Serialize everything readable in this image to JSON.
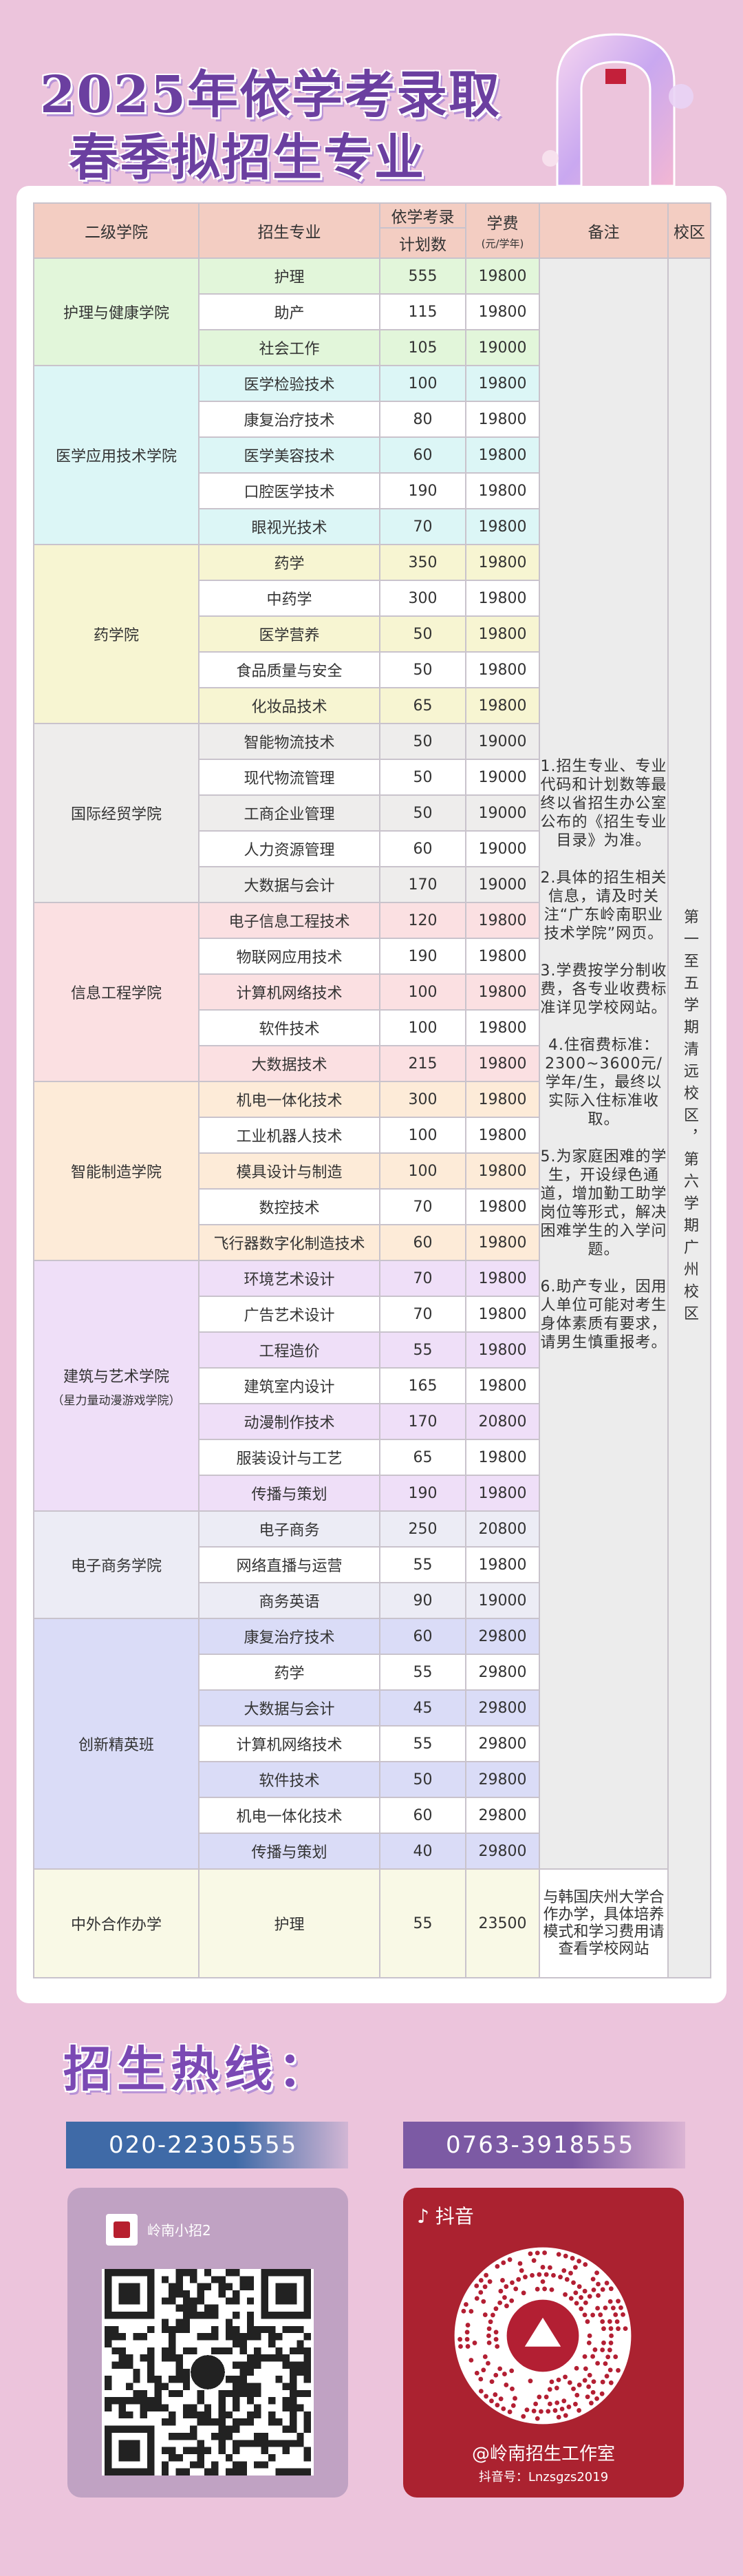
{
  "header": {
    "title_line1": "2025年依学考录取",
    "title_line2": "春季拟招生专业"
  },
  "table": {
    "head": {
      "college": "二级学院",
      "major": "招生专业",
      "plan_top": "依学考录",
      "plan_bottom": "计划数",
      "fee_top": "学费",
      "fee_bottom": "(元/学年)",
      "note": "备注",
      "campus": "校区"
    },
    "groups": [
      {
        "college": "护理与健康学院",
        "rows": [
          {
            "major": "护理",
            "num": "555",
            "fee": "19800"
          },
          {
            "major": "助产",
            "num": "115",
            "fee": "19800"
          },
          {
            "major": "社会工作",
            "num": "105",
            "fee": "19000"
          }
        ]
      },
      {
        "college": "医学应用技术学院",
        "rows": [
          {
            "major": "医学检验技术",
            "num": "100",
            "fee": "19800"
          },
          {
            "major": "康复治疗技术",
            "num": "80",
            "fee": "19800"
          },
          {
            "major": "医学美容技术",
            "num": "60",
            "fee": "19800"
          },
          {
            "major": "口腔医学技术",
            "num": "190",
            "fee": "19800"
          },
          {
            "major": "眼视光技术",
            "num": "70",
            "fee": "19800"
          }
        ]
      },
      {
        "college": "药学院",
        "rows": [
          {
            "major": "药学",
            "num": "350",
            "fee": "19800"
          },
          {
            "major": "中药学",
            "num": "300",
            "fee": "19800"
          },
          {
            "major": "医学营养",
            "num": "50",
            "fee": "19800"
          },
          {
            "major": "食品质量与安全",
            "num": "50",
            "fee": "19800"
          },
          {
            "major": "化妆品技术",
            "num": "65",
            "fee": "19800"
          }
        ]
      },
      {
        "college": "国际经贸学院",
        "rows": [
          {
            "major": "智能物流技术",
            "num": "50",
            "fee": "19000"
          },
          {
            "major": "现代物流管理",
            "num": "50",
            "fee": "19000"
          },
          {
            "major": "工商企业管理",
            "num": "50",
            "fee": "19000"
          },
          {
            "major": "人力资源管理",
            "num": "60",
            "fee": "19000"
          },
          {
            "major": "大数据与会计",
            "num": "170",
            "fee": "19000"
          }
        ]
      },
      {
        "college": "信息工程学院",
        "rows": [
          {
            "major": "电子信息工程技术",
            "num": "120",
            "fee": "19800"
          },
          {
            "major": "物联网应用技术",
            "num": "190",
            "fee": "19800"
          },
          {
            "major": "计算机网络技术",
            "num": "100",
            "fee": "19800"
          },
          {
            "major": "软件技术",
            "num": "100",
            "fee": "19800"
          },
          {
            "major": "大数据技术",
            "num": "215",
            "fee": "19800"
          }
        ]
      },
      {
        "college": "智能制造学院",
        "rows": [
          {
            "major": "机电一体化技术",
            "num": "300",
            "fee": "19800"
          },
          {
            "major": "工业机器人技术",
            "num": "100",
            "fee": "19800"
          },
          {
            "major": "模具设计与制造",
            "num": "100",
            "fee": "19800"
          },
          {
            "major": "数控技术",
            "num": "70",
            "fee": "19800"
          },
          {
            "major": "飞行器数字化制造技术",
            "num": "60",
            "fee": "19800"
          }
        ]
      },
      {
        "college": "建筑与艺术学院",
        "college_sub": "（星力量动漫游戏学院）",
        "rows": [
          {
            "major": "环境艺术设计",
            "num": "70",
            "fee": "19800"
          },
          {
            "major": "广告艺术设计",
            "num": "70",
            "fee": "19800"
          },
          {
            "major": "工程造价",
            "num": "55",
            "fee": "19800"
          },
          {
            "major": "建筑室内设计",
            "num": "165",
            "fee": "19800"
          },
          {
            "major": "动漫制作技术",
            "num": "170",
            "fee": "20800"
          },
          {
            "major": "服装设计与工艺",
            "num": "65",
            "fee": "19800"
          },
          {
            "major": "传播与策划",
            "num": "190",
            "fee": "19800"
          }
        ]
      },
      {
        "college": "电子商务学院",
        "rows": [
          {
            "major": "电子商务",
            "num": "250",
            "fee": "20800"
          },
          {
            "major": "网络直播与运营",
            "num": "55",
            "fee": "19800"
          },
          {
            "major": "商务英语",
            "num": "90",
            "fee": "19000"
          }
        ]
      },
      {
        "college": "创新精英班",
        "rows": [
          {
            "major": "康复治疗技术",
            "num": "60",
            "fee": "29800"
          },
          {
            "major": "药学",
            "num": "55",
            "fee": "29800"
          },
          {
            "major": "大数据与会计",
            "num": "45",
            "fee": "29800"
          },
          {
            "major": "计算机网络技术",
            "num": "55",
            "fee": "29800"
          },
          {
            "major": "软件技术",
            "num": "50",
            "fee": "29800"
          },
          {
            "major": "机电一体化技术",
            "num": "60",
            "fee": "29800"
          },
          {
            "major": "传播与策划",
            "num": "40",
            "fee": "29800"
          }
        ]
      }
    ],
    "coop": {
      "college": "中外合作办学",
      "major": "护理",
      "num": "55",
      "fee": "23500",
      "note": "与韩国庆州大学合作办学，具体培养模式和学习费用请查看学校网站"
    },
    "notes": [
      "1.招生专业、专业代码和计划数等最终以省招生办公室公布的《招生专业目录》为准。",
      "2.具体的招生相关信息，请及时关注“广东岭南职业技术学院”网页。",
      "3.学费按学分制收费，各专业收费标准详见学校网站。",
      "4.住宿费标准：2300~3600元/学年/生，最终以实际入住标准收取。",
      "5.为家庭困难的学生，开设绿色通道，增加勤工助学岗位等形式，解决困难学生的入学问题。",
      "6.助产专业，因用人单位可能对考生身体素质有要求，请男生慎重报考。"
    ],
    "campus_text": "第一至五学期清远校区，第六学期广州校区"
  },
  "hotline": {
    "title": "招生热线：",
    "phone1": "020-22305555",
    "phone2": "0763-3918555"
  },
  "wechat": {
    "name": "岭南小招2",
    "icon": "wechat-icon"
  },
  "douyin": {
    "app": "抖音",
    "name": "@岭南招生工作室",
    "id": "抖音号：Lnzsgzs2019",
    "icon": "tiktok-icon"
  },
  "colors": {
    "background": "#ecc4dc",
    "title": "#6b3fa0",
    "header_cell": "#f3cdc2",
    "phone1": "#3f6aa7",
    "phone2": "#7c5aa4",
    "douyin_card": "#ab2230"
  }
}
